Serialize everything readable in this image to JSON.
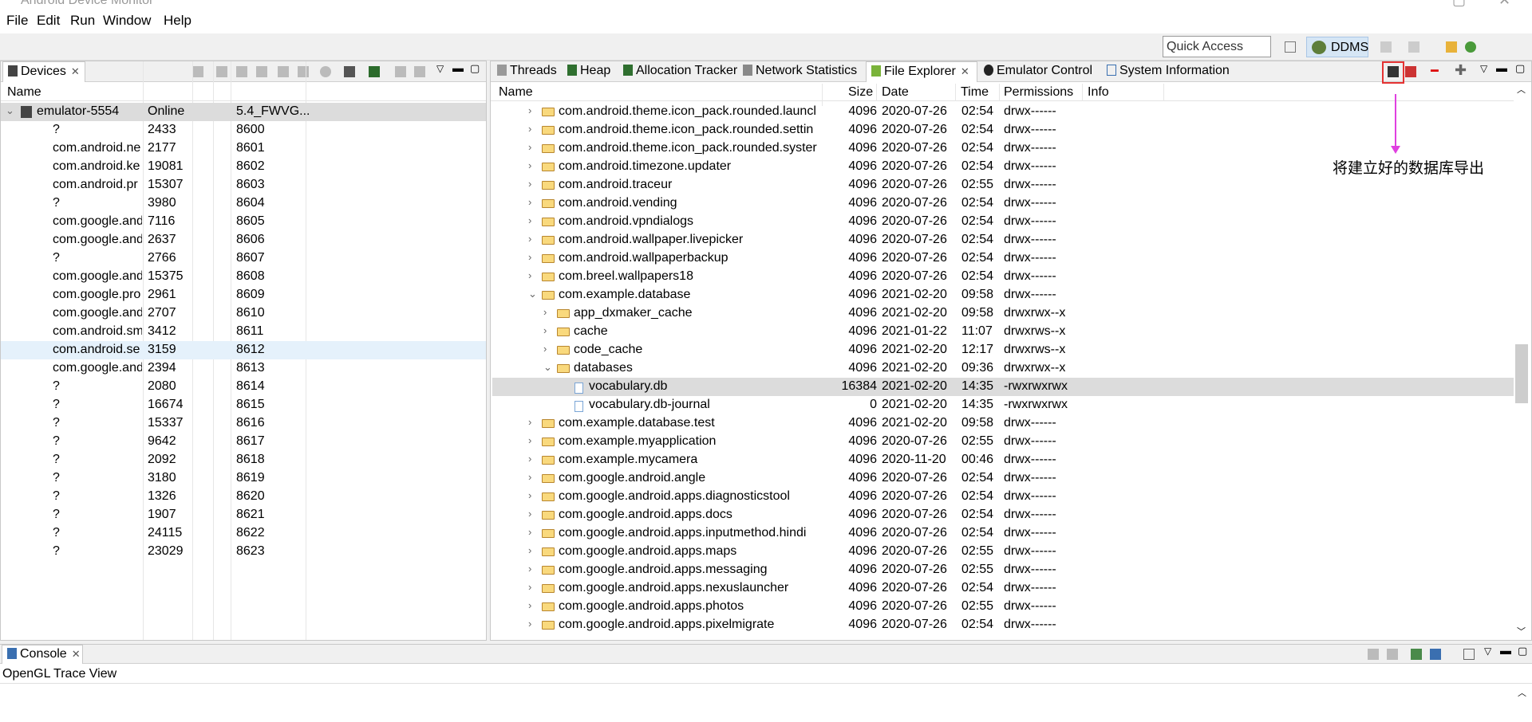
{
  "window": {
    "title": "Android Device Monitor"
  },
  "menu": [
    "File",
    "Edit",
    "Run",
    "Window",
    "Help"
  ],
  "toolbar": {
    "quick_access": "Quick Access",
    "perspective": "DDMS"
  },
  "devices": {
    "tab": "Devices",
    "headers": [
      "Name"
    ],
    "device": {
      "name": "emulator-5554",
      "status": "Online",
      "version": "5.4_FWVG..."
    },
    "processes": [
      [
        "?",
        "2433",
        "8600"
      ],
      [
        "com.android.ne",
        "2177",
        "8601"
      ],
      [
        "com.android.ke",
        "19081",
        "8602"
      ],
      [
        "com.android.pr",
        "15307",
        "8603"
      ],
      [
        "?",
        "3980",
        "8604"
      ],
      [
        "com.google.and",
        "7116",
        "8605"
      ],
      [
        "com.google.and",
        "2637",
        "8606"
      ],
      [
        "?",
        "2766",
        "8607"
      ],
      [
        "com.google.and",
        "15375",
        "8608"
      ],
      [
        "com.google.pro",
        "2961",
        "8609"
      ],
      [
        "com.google.and",
        "2707",
        "8610"
      ],
      [
        "com.android.sm",
        "3412",
        "8611"
      ],
      [
        "com.android.se",
        "3159",
        "8612"
      ],
      [
        "com.google.and",
        "2394",
        "8613"
      ],
      [
        "?",
        "2080",
        "8614"
      ],
      [
        "?",
        "16674",
        "8615"
      ],
      [
        "?",
        "15337",
        "8616"
      ],
      [
        "?",
        "9642",
        "8617"
      ],
      [
        "?",
        "2092",
        "8618"
      ],
      [
        "?",
        "3180",
        "8619"
      ],
      [
        "?",
        "1326",
        "8620"
      ],
      [
        "?",
        "1907",
        "8621"
      ],
      [
        "?",
        "24115",
        "8622"
      ],
      [
        "?",
        "23029",
        "8623"
      ]
    ]
  },
  "tabs": [
    "Threads",
    "Heap",
    "Allocation Tracker",
    "Network Statistics",
    "File Explorer",
    "Emulator Control",
    "System Information"
  ],
  "file_explorer": {
    "headers": [
      "Name",
      "Size",
      "Date",
      "Time",
      "Permissions",
      "Info"
    ],
    "rows": [
      {
        "name": "com.android.theme.icon_pack.rounded.launcl",
        "size": "4096",
        "date": "2020-07-26",
        "time": "02:54",
        "perm": "drwx------",
        "type": "folder",
        "level": 0,
        "expanded": false
      },
      {
        "name": "com.android.theme.icon_pack.rounded.settin",
        "size": "4096",
        "date": "2020-07-26",
        "time": "02:54",
        "perm": "drwx------",
        "type": "folder",
        "level": 0,
        "expanded": false
      },
      {
        "name": "com.android.theme.icon_pack.rounded.syster",
        "size": "4096",
        "date": "2020-07-26",
        "time": "02:54",
        "perm": "drwx------",
        "type": "folder",
        "level": 0,
        "expanded": false
      },
      {
        "name": "com.android.timezone.updater",
        "size": "4096",
        "date": "2020-07-26",
        "time": "02:54",
        "perm": "drwx------",
        "type": "folder",
        "level": 0,
        "expanded": false
      },
      {
        "name": "com.android.traceur",
        "size": "4096",
        "date": "2020-07-26",
        "time": "02:55",
        "perm": "drwx------",
        "type": "folder",
        "level": 0,
        "expanded": false
      },
      {
        "name": "com.android.vending",
        "size": "4096",
        "date": "2020-07-26",
        "time": "02:54",
        "perm": "drwx------",
        "type": "folder",
        "level": 0,
        "expanded": false
      },
      {
        "name": "com.android.vpndialogs",
        "size": "4096",
        "date": "2020-07-26",
        "time": "02:54",
        "perm": "drwx------",
        "type": "folder",
        "level": 0,
        "expanded": false
      },
      {
        "name": "com.android.wallpaper.livepicker",
        "size": "4096",
        "date": "2020-07-26",
        "time": "02:54",
        "perm": "drwx------",
        "type": "folder",
        "level": 0,
        "expanded": false
      },
      {
        "name": "com.android.wallpaperbackup",
        "size": "4096",
        "date": "2020-07-26",
        "time": "02:54",
        "perm": "drwx------",
        "type": "folder",
        "level": 0,
        "expanded": false
      },
      {
        "name": "com.breel.wallpapers18",
        "size": "4096",
        "date": "2020-07-26",
        "time": "02:54",
        "perm": "drwx------",
        "type": "folder",
        "level": 0,
        "expanded": false
      },
      {
        "name": "com.example.database",
        "size": "4096",
        "date": "2021-02-20",
        "time": "09:58",
        "perm": "drwx------",
        "type": "folder",
        "level": 0,
        "expanded": true
      },
      {
        "name": "app_dxmaker_cache",
        "size": "4096",
        "date": "2021-02-20",
        "time": "09:58",
        "perm": "drwxrwx--x",
        "type": "folder",
        "level": 1,
        "expanded": false
      },
      {
        "name": "cache",
        "size": "4096",
        "date": "2021-01-22",
        "time": "11:07",
        "perm": "drwxrws--x",
        "type": "folder",
        "level": 1,
        "expanded": false
      },
      {
        "name": "code_cache",
        "size": "4096",
        "date": "2021-02-20",
        "time": "12:17",
        "perm": "drwxrws--x",
        "type": "folder",
        "level": 1,
        "expanded": false
      },
      {
        "name": "databases",
        "size": "4096",
        "date": "2021-02-20",
        "time": "09:36",
        "perm": "drwxrwx--x",
        "type": "folder",
        "level": 1,
        "expanded": true
      },
      {
        "name": "vocabulary.db",
        "size": "16384",
        "date": "2021-02-20",
        "time": "14:35",
        "perm": "-rwxrwxrwx",
        "type": "file",
        "level": 2,
        "selected": true
      },
      {
        "name": "vocabulary.db-journal",
        "size": "0",
        "date": "2021-02-20",
        "time": "14:35",
        "perm": "-rwxrwxrwx",
        "type": "file",
        "level": 2
      },
      {
        "name": "com.example.database.test",
        "size": "4096",
        "date": "2021-02-20",
        "time": "09:58",
        "perm": "drwx------",
        "type": "folder",
        "level": 0,
        "expanded": false
      },
      {
        "name": "com.example.myapplication",
        "size": "4096",
        "date": "2020-07-26",
        "time": "02:55",
        "perm": "drwx------",
        "type": "folder",
        "level": 0,
        "expanded": false
      },
      {
        "name": "com.example.mycamera",
        "size": "4096",
        "date": "2020-11-20",
        "time": "00:46",
        "perm": "drwx------",
        "type": "folder",
        "level": 0,
        "expanded": false
      },
      {
        "name": "com.google.android.angle",
        "size": "4096",
        "date": "2020-07-26",
        "time": "02:54",
        "perm": "drwx------",
        "type": "folder",
        "level": 0,
        "expanded": false
      },
      {
        "name": "com.google.android.apps.diagnosticstool",
        "size": "4096",
        "date": "2020-07-26",
        "time": "02:54",
        "perm": "drwx------",
        "type": "folder",
        "level": 0,
        "expanded": false
      },
      {
        "name": "com.google.android.apps.docs",
        "size": "4096",
        "date": "2020-07-26",
        "time": "02:54",
        "perm": "drwx------",
        "type": "folder",
        "level": 0,
        "expanded": false
      },
      {
        "name": "com.google.android.apps.inputmethod.hindi",
        "size": "4096",
        "date": "2020-07-26",
        "time": "02:54",
        "perm": "drwx------",
        "type": "folder",
        "level": 0,
        "expanded": false
      },
      {
        "name": "com.google.android.apps.maps",
        "size": "4096",
        "date": "2020-07-26",
        "time": "02:55",
        "perm": "drwx------",
        "type": "folder",
        "level": 0,
        "expanded": false
      },
      {
        "name": "com.google.android.apps.messaging",
        "size": "4096",
        "date": "2020-07-26",
        "time": "02:55",
        "perm": "drwx------",
        "type": "folder",
        "level": 0,
        "expanded": false
      },
      {
        "name": "com.google.android.apps.nexuslauncher",
        "size": "4096",
        "date": "2020-07-26",
        "time": "02:54",
        "perm": "drwx------",
        "type": "folder",
        "level": 0,
        "expanded": false
      },
      {
        "name": "com.google.android.apps.photos",
        "size": "4096",
        "date": "2020-07-26",
        "time": "02:55",
        "perm": "drwx------",
        "type": "folder",
        "level": 0,
        "expanded": false
      },
      {
        "name": "com.google.android.apps.pixelmigrate",
        "size": "4096",
        "date": "2020-07-26",
        "time": "02:54",
        "perm": "drwx------",
        "type": "folder",
        "level": 0,
        "expanded": false
      }
    ]
  },
  "annotation": {
    "text": "将建立好的数据库导出",
    "color": "#e040e0",
    "box_color": "#e53333"
  },
  "console": {
    "tab": "Console",
    "view": "OpenGL Trace View"
  },
  "colors": {
    "selection": "#dcdcdc",
    "highlight": "#e5f1fb"
  }
}
